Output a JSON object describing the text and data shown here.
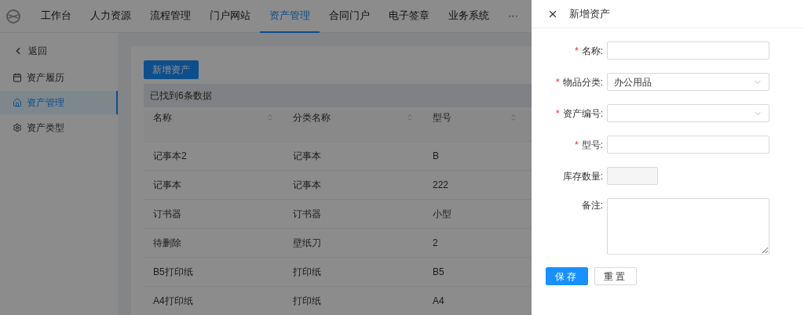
{
  "nav": {
    "items": [
      {
        "label": "工作台",
        "selected": false
      },
      {
        "label": "人力资源",
        "selected": false
      },
      {
        "label": "流程管理",
        "selected": false
      },
      {
        "label": "门户网站",
        "selected": false
      },
      {
        "label": "资产管理",
        "selected": true
      },
      {
        "label": "合同门户",
        "selected": false
      },
      {
        "label": "电子签章",
        "selected": false
      },
      {
        "label": "业务系统",
        "selected": false
      },
      {
        "label": "···",
        "selected": false
      }
    ]
  },
  "sidebar": {
    "back": "返回",
    "items": [
      {
        "label": "资产履历",
        "selected": false
      },
      {
        "label": "资产管理",
        "selected": true
      },
      {
        "label": "资产类型",
        "selected": false
      }
    ]
  },
  "main": {
    "add_button": "新增资产",
    "result_text": "已找到6条数据",
    "table": {
      "columns": [
        "名称",
        "分类名称",
        "型号"
      ],
      "rows": [
        [
          "记事本2",
          "记事本",
          "B"
        ],
        [
          "记事本",
          "记事本",
          "222"
        ],
        [
          "订书器",
          "订书器",
          "小型"
        ],
        [
          "待删除",
          "壁纸刀",
          "2"
        ],
        [
          "B5打印纸",
          "打印纸",
          "B5"
        ],
        [
          "A4打印纸",
          "打印纸",
          "A4"
        ]
      ]
    }
  },
  "drawer": {
    "title": "新增资产",
    "fields": [
      {
        "label": "名称:",
        "required_mark": "*",
        "kind": "input"
      },
      {
        "label": "物品分类:",
        "required_mark": "*",
        "kind": "select",
        "value": "办公用品"
      },
      {
        "label": "资产编号:",
        "required_mark": "*",
        "kind": "select"
      },
      {
        "label": "型号:",
        "required_mark": "*",
        "kind": "input"
      },
      {
        "label": "库存数量:",
        "kind": "disabled"
      },
      {
        "label": "备注:",
        "kind": "textarea"
      }
    ],
    "buttons": [
      {
        "label": "保存",
        "primary": true
      },
      {
        "label": "重置",
        "primary": false
      }
    ]
  }
}
